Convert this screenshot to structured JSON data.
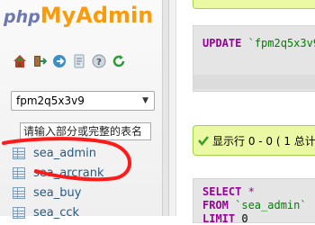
{
  "app": {
    "logo_php": "php",
    "logo_myadmin": "MyAdmin",
    "accent_orange": "#f89c0e",
    "accent_blue": "#6c78af"
  },
  "nav_icons": [
    "home-icon",
    "logout-icon",
    "query-window-icon",
    "docs-icon",
    "help-icon",
    "reload-icon"
  ],
  "database_select": {
    "value": "fpm2q5x3v9",
    "caret": "▼"
  },
  "table_filter": {
    "placeholder": "请输入部分或完整的表名"
  },
  "tables": [
    {
      "label": "sea_admin"
    },
    {
      "label": "sea_arcrank"
    },
    {
      "label": "sea_buy"
    },
    {
      "label": "sea_cck"
    }
  ],
  "main": {
    "query1": {
      "keyword": "UPDATE",
      "table": "`fpm2q5x3v9`"
    },
    "success": {
      "text": "显示行 0 - 0 ( 1 总计"
    },
    "query2": {
      "select_kw": "SELECT",
      "select_rest": " *",
      "from_kw": "FROM",
      "from_rest": " `sea_admin`",
      "limit_kw": "LIMIT",
      "limit_rest": " 0"
    }
  },
  "colors": {
    "link": "#235a81",
    "success_bg": "#ebf8a4",
    "success_border": "#a2d246",
    "sql_keyword": "#990099",
    "sql_string": "#008000",
    "annotation_red": "#ff1a1a"
  }
}
